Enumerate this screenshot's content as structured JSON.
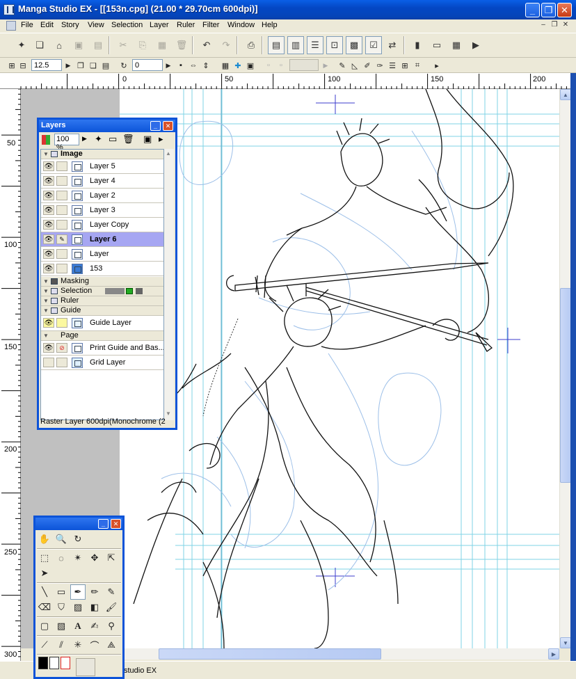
{
  "window": {
    "title": "Manga Studio EX - [[153n.cpg] (21.00 * 29.70cm 600dpi)]"
  },
  "menu": [
    "File",
    "Edit",
    "Story",
    "View",
    "Selection",
    "Layer",
    "Ruler",
    "Filter",
    "Window",
    "Help"
  ],
  "toolbar2": {
    "zoom_value": "12.5",
    "rotate_value": "0"
  },
  "hruler": [
    "0",
    "50",
    "100",
    "150",
    "200"
  ],
  "vruler": [
    "50",
    "100",
    "150",
    "200",
    "250",
    "300"
  ],
  "layers_panel": {
    "title": "Layers",
    "opacity": "100 %",
    "groups": {
      "image": "Image",
      "masking": "Masking",
      "selection": "Selection",
      "ruler": "Ruler",
      "guide": "Guide",
      "page": "Page"
    },
    "image_layers": [
      "Layer 5",
      "Layer 4",
      "Layer 2",
      "Layer 3",
      "Layer Copy",
      "Layer 6",
      "Layer",
      "153"
    ],
    "selected_layer": "Layer 6",
    "guide_layers": [
      "Guide Layer"
    ],
    "page_layers": [
      "Print Guide and Bas...",
      "Grid Layer"
    ],
    "status": "Raster Layer 600dpi(Monochrome (2"
  },
  "statusbar": {
    "text": "studio EX"
  },
  "colors": {
    "titlebar": "#0447c4",
    "selected_row": "#a6a6f2",
    "guide": "#7fd3e6",
    "sketch": "#9cbfe8"
  }
}
